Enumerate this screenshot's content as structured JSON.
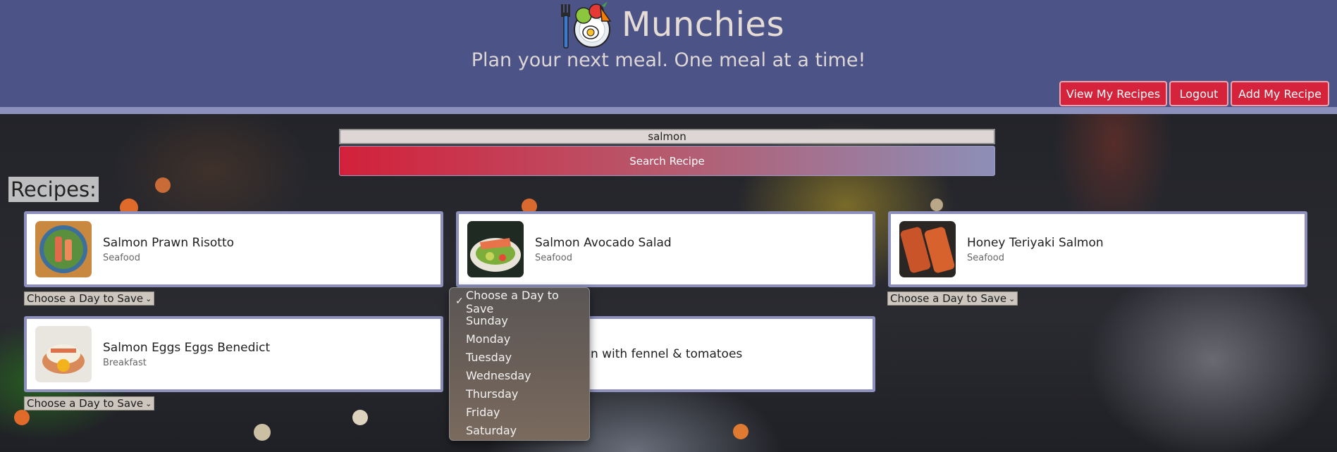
{
  "header": {
    "title": "Munchies",
    "tagline": "Plan your next meal. One meal at a time!",
    "logo_icon": "plate-fork-egg-logo"
  },
  "nav": {
    "view_recipes": "View My Recipes",
    "logout": "Logout",
    "add_recipe": "Add My Recipe"
  },
  "search": {
    "value": "salmon",
    "button": "Search Recipe"
  },
  "recipes_heading": "Recipes:",
  "day_select_label": "Choose a Day to Save",
  "recipes": [
    {
      "title": "Salmon Prawn Risotto",
      "category": "Seafood"
    },
    {
      "title": "Salmon Avocado Salad",
      "category": "Seafood"
    },
    {
      "title": "Honey Teriyaki Salmon",
      "category": "Seafood"
    },
    {
      "title": "Salmon Eggs Eggs Benedict",
      "category": "Breakfast"
    },
    {
      "title": "mon with fennel & tomatoes",
      "category": ""
    }
  ],
  "dropdown": {
    "selected": "Choose a Day to Save",
    "options": [
      "Choose a Day to Save",
      "Sunday",
      "Monday",
      "Tuesday",
      "Wednesday",
      "Thursday",
      "Friday",
      "Saturday"
    ]
  },
  "colors": {
    "header": "#4c5487",
    "accent": "#d6233c",
    "card_border": "#8d90bd"
  }
}
